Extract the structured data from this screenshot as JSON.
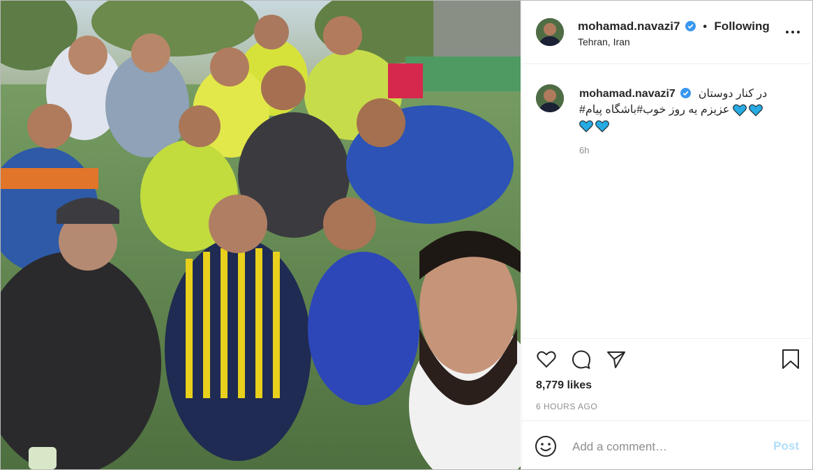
{
  "post": {
    "photo_alt": "",
    "header": {
      "username": "mohamad.navazi7",
      "separator": "•",
      "follow_status": "Following",
      "location": "Tehran, Iran",
      "more_icon": "more-horizontal-icon"
    },
    "caption": {
      "username": "mohamad.navazi7",
      "line1": "در کنار دوستان",
      "line2": "عزیزم یه روز خوب#باشگاه پیام#",
      "hearts": [
        "blue-heart",
        "blue-heart",
        "blue-heart",
        "blue-heart"
      ],
      "time": "6h"
    },
    "actions": {
      "like_icon": "heart-icon",
      "comment_icon": "comment-icon",
      "share_icon": "paper-plane-icon",
      "save_icon": "bookmark-icon"
    },
    "likes": "8,779 likes",
    "time_ago": "6 HOURS AGO",
    "comment": {
      "placeholder": "Add a comment…",
      "post_label": "Post",
      "emoji_icon": "smiley-icon"
    }
  },
  "colors": {
    "verified": "#3897f0",
    "heart": "#27a9e1",
    "post_disabled": "#b2dffc",
    "text": "#262626",
    "muted": "#8e8e8e"
  }
}
